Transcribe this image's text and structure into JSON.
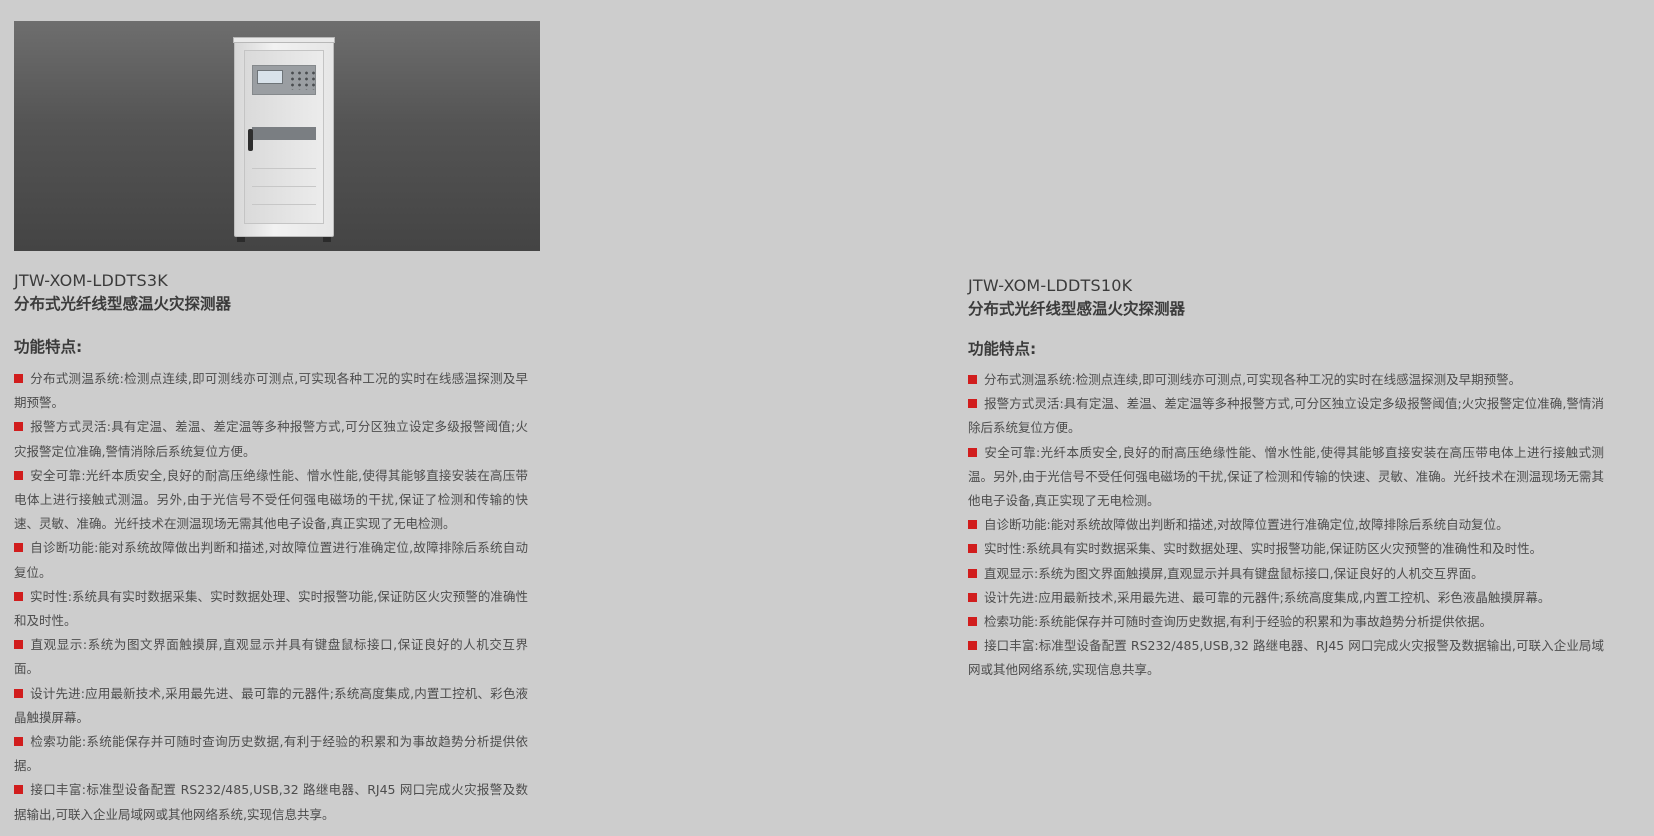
{
  "products": [
    {
      "model": "JTW-XOM-LDDTS3K",
      "name": "分布式光纤线型感温火灾探测器",
      "features_heading": "功能特点:",
      "features": [
        "分布式测温系统:检测点连续,即可测线亦可测点,可实现各种工况的实时在线感温探测及早期预警。",
        "报警方式灵活:具有定温、差温、差定温等多种报警方式,可分区独立设定多级报警阈值;火灾报警定位准确,警情消除后系统复位方便。",
        "安全可靠:光纤本质安全,良好的耐高压绝缘性能、憎水性能,使得其能够直接安装在高压带电体上进行接触式测温。另外,由于光信号不受任何强电磁场的干扰,保证了检测和传输的快速、灵敏、准确。光纤技术在测温现场无需其他电子设备,真正实现了无电检测。",
        "自诊断功能:能对系统故障做出判断和描述,对故障位置进行准确定位,故障排除后系统自动复位。",
        "实时性:系统具有实时数据采集、实时数据处理、实时报警功能,保证防区火灾预警的准确性和及时性。",
        "直观显示:系统为图文界面触摸屏,直观显示并具有键盘鼠标接口,保证良好的人机交互界面。",
        "设计先进:应用最新技术,采用最先进、最可靠的元器件;系统高度集成,内置工控机、彩色液晶触摸屏幕。",
        "检索功能:系统能保存并可随时查询历史数据,有利于经验的积累和为事故趋势分析提供依据。",
        "接口丰富:标准型设备配置 RS232/485,USB,32 路继电器、RJ45 网口完成火灾报警及数据输出,可联入企业局域网或其他网络系统,实现信息共享。"
      ]
    },
    {
      "model": "JTW-XOM-LDDTS10K",
      "name": "分布式光纤线型感温火灾探测器",
      "features_heading": "功能特点:",
      "features": [
        "分布式测温系统:检测点连续,即可测线亦可测点,可实现各种工况的实时在线感温探测及早期预警。",
        "报警方式灵活:具有定温、差温、差定温等多种报警方式,可分区独立设定多级报警阈值;火灾报警定位准确,警情消除后系统复位方便。",
        "安全可靠:光纤本质安全,良好的耐高压绝缘性能、憎水性能,使得其能够直接安装在高压带电体上进行接触式测温。另外,由于光信号不受任何强电磁场的干扰,保证了检测和传输的快速、灵敏、准确。光纤技术在测温现场无需其他电子设备,真正实现了无电检测。",
        "自诊断功能:能对系统故障做出判断和描述,对故障位置进行准确定位,故障排除后系统自动复位。",
        "实时性:系统具有实时数据采集、实时数据处理、实时报警功能,保证防区火灾预警的准确性和及时性。",
        "直观显示:系统为图文界面触摸屏,直观显示并具有键盘鼠标接口,保证良好的人机交互界面。",
        "设计先进:应用最新技术,采用最先进、最可靠的元器件;系统高度集成,内置工控机、彩色液晶触摸屏幕。",
        "检索功能:系统能保存并可随时查询历史数据,有利于经验的积累和为事故趋势分析提供依据。",
        "接口丰富:标准型设备配置 RS232/485,USB,32 路继电器、RJ45 网口完成火灾报警及数据输出,可联入企业局域网或其他网络系统,实现信息共享。"
      ]
    }
  ],
  "colors": {
    "background": "#cdcdcd",
    "bullet": "#d11d1d",
    "text": "#3b3b3b"
  },
  "icons": {
    "bullet": "red-square-bullet-icon"
  }
}
